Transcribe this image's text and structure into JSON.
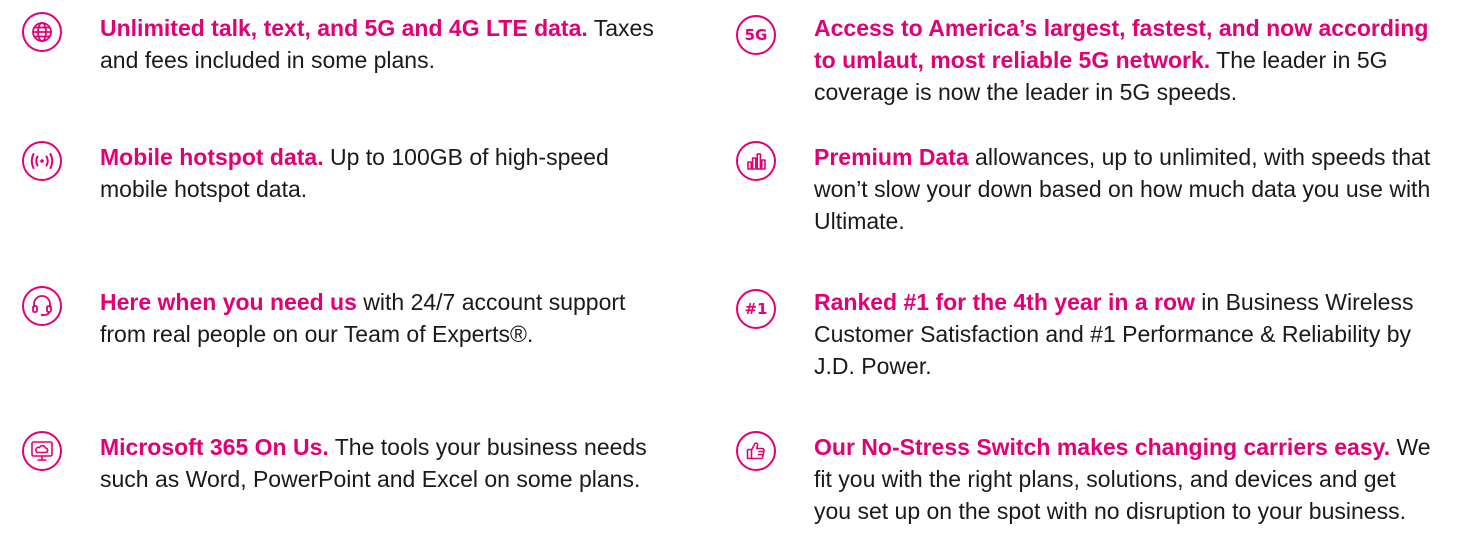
{
  "colors": {
    "accent": "#e20074",
    "body_text": "#1a1a1a"
  },
  "features": {
    "left": [
      {
        "icon": "globe-icon",
        "highlight": "Unlimited talk, text, and 5G and 4G LTE data.",
        "body": " Taxes and fees included in some plans."
      },
      {
        "icon": "hotspot-icon",
        "highlight": "Mobile hotspot data.",
        "body": " Up to 100GB of high-speed mobile hotspot data."
      },
      {
        "icon": "headset-icon",
        "highlight": "Here when you need us",
        "body": " with 24/7 account support from real people on our Team of Experts®."
      },
      {
        "icon": "cloud-monitor-icon",
        "highlight": "Microsoft 365 On Us.",
        "body": " The tools your business needs such as Word, PowerPoint and Excel on some plans."
      }
    ],
    "right": [
      {
        "icon": "5g-icon",
        "icon_text": "5G",
        "highlight": "Access to America’s largest, fastest, and now according to umlaut, most reliable 5G network.",
        "body": "  The leader in 5G coverage is now the leader in 5G speeds."
      },
      {
        "icon": "bar-chart-icon",
        "highlight": "Premium Data",
        "body": " allowances, up to unlimited, with speeds that won’t slow your down based on how much data you use with Ultimate."
      },
      {
        "icon": "number-one-icon",
        "icon_text": "#1",
        "highlight": "Ranked #1 for the 4th year in a row",
        "body": " in Business Wireless Customer Satisfaction and #1 Performance & Reliability by J.D. Power."
      },
      {
        "icon": "thumbs-up-icon",
        "highlight": "Our No-Stress Switch makes changing carriers easy.",
        "body": " We fit you with the right plans, solutions, and devices and get you set up on the spot with no disruption to your business."
      }
    ]
  }
}
